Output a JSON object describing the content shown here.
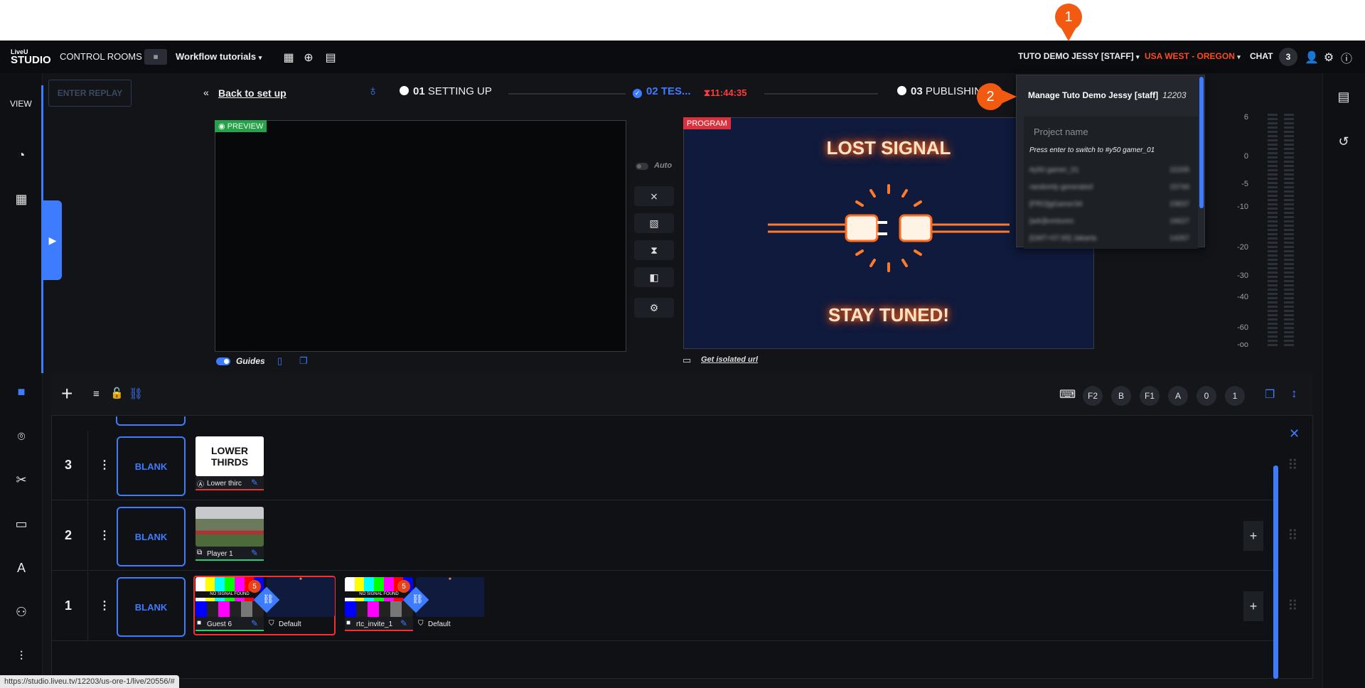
{
  "topbar": {
    "logo_top": "LiveU",
    "logo_bottom": "STUDIO",
    "control_rooms": "CONTROL ROOMS",
    "workflow": "Workflow tutorials",
    "user": "TUTO DEMO JESSY [STAFF]",
    "region": "USA WEST - OREGON",
    "chat_label": "CHAT",
    "chat_count": "3"
  },
  "left_rail": {
    "view_label": "VIEW"
  },
  "header": {
    "replay": "ENTER REPLAY",
    "back": "Back to set up",
    "step1_num": "01",
    "step1_label": "SETTING UP",
    "step2_num": "02",
    "step2_label": "TES...",
    "timer": "11:44:35",
    "step3_num": "03",
    "step3_label": "PUBLISHIN"
  },
  "preview": {
    "tag": "PREVIEW",
    "guides": "Guides"
  },
  "program": {
    "tag": "PROGRAM",
    "line1": "LOST SIGNAL",
    "line2": "STAY TUNED!",
    "isolated": "Get isolated url"
  },
  "transitions": {
    "auto": "Auto"
  },
  "dropdown": {
    "manage": "Manage Tuto Demo Jessy [staff]",
    "manage_id": "12203",
    "placeholder": "Project name",
    "hint": "Press enter to switch to #y50 gamer_01",
    "rows": [
      {
        "name": "#y50 gamer_01",
        "id": "22205"
      },
      {
        "name": "randomly generated",
        "id": "15744"
      },
      {
        "name": "[PRO]gGamer34",
        "id": "23837"
      },
      {
        "name": "[adv]kvmtures",
        "id": "16627"
      },
      {
        "name": "[GMT+07:00] Jakarta",
        "id": "14267"
      }
    ]
  },
  "meter": {
    "labels": [
      "6",
      "0",
      "-5",
      "-10",
      "-20",
      "-30",
      "-40",
      "-60",
      "-oo"
    ]
  },
  "callouts": {
    "one": "1",
    "two": "2"
  },
  "timeline": {
    "keys": [
      "F2",
      "B",
      "F1",
      "A",
      "0",
      "1"
    ],
    "layers": [
      {
        "num": "3",
        "blank": "BLANK",
        "items": [
          {
            "label": "Lower thirc",
            "thumb_text": "LOWER THIRDS"
          }
        ]
      },
      {
        "num": "2",
        "blank": "BLANK",
        "items": [
          {
            "label": "Player 1"
          }
        ]
      },
      {
        "num": "1",
        "blank": "BLANK",
        "items": [
          {
            "label": "Guest 6",
            "badge": "5",
            "mask": "Default"
          },
          {
            "label": "rtc_invite_1",
            "badge": "5",
            "mask": "Default"
          }
        ]
      }
    ],
    "no_signal": "NO SIGNAL FOUND"
  },
  "status": {
    "url": "https://studio.liveu.tv/12203/us-ore-1/live/20556/#"
  },
  "colors": {
    "accent": "#3d7bff",
    "brand": "#ff4a1c",
    "callout": "#f25a12"
  }
}
